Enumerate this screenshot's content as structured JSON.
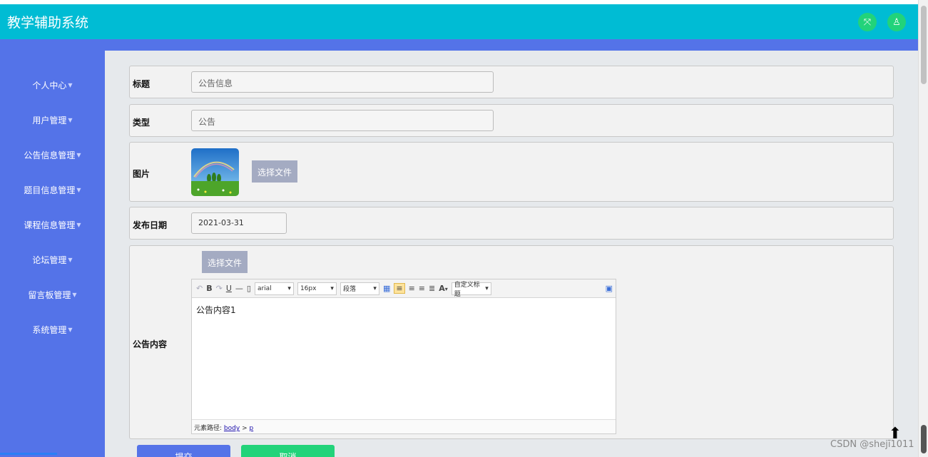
{
  "app": {
    "title": "教学辅助系统"
  },
  "header": {
    "fullscreen_icon": "expand-icon",
    "user_icon": "user-icon"
  },
  "sidebar": {
    "items": [
      {
        "label": "个人中心"
      },
      {
        "label": "用户管理"
      },
      {
        "label": "公告信息管理"
      },
      {
        "label": "题目信息管理"
      },
      {
        "label": "课程信息管理"
      },
      {
        "label": "论坛管理"
      },
      {
        "label": "留言板管理"
      },
      {
        "label": "系统管理"
      }
    ]
  },
  "form": {
    "title_label": "标题",
    "title_value": "公告信息",
    "type_label": "类型",
    "type_value": "公告",
    "image_label": "图片",
    "choose_file_label": "选择文件",
    "date_label": "发布日期",
    "date_value": "2021-03-31",
    "content_label": "公告内容",
    "content_choose_file_label": "选择文件"
  },
  "editor": {
    "font_family": "arial",
    "font_size": "16px",
    "paragraph": "段落",
    "custom_title": "自定义标题",
    "bold": "B",
    "underline": "U",
    "font_color": "A",
    "content": "公告内容1",
    "path_label": "元素路径:",
    "path_body": "body",
    "path_sep": ">",
    "path_p": "p"
  },
  "actions": {
    "submit_label": "提交",
    "cancel_label": "取消"
  },
  "watermark": "CSDN @shejī1011",
  "colors": {
    "header": "#00bcd4",
    "sidebar": "#5473e8",
    "accent_green": "#22d37a"
  }
}
